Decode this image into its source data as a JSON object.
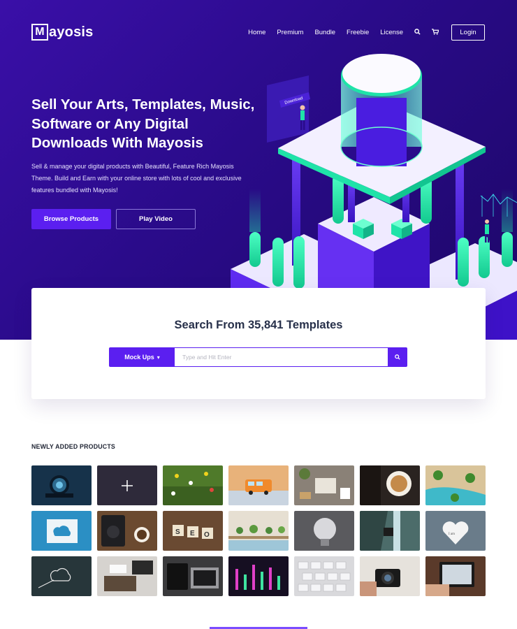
{
  "brand": {
    "logo_letter": "M",
    "logo_rest": "ayosis"
  },
  "nav": {
    "items": [
      "Home",
      "Premium",
      "Bundle",
      "Freebie",
      "License"
    ],
    "search_icon": "🔍",
    "cart_icon": "🛒",
    "login_label": "Login"
  },
  "hero": {
    "title": "Sell Your Arts, Templates, Music, Software or Any Digital Downloads With Mayosis",
    "subtitle": "Sell & manage your digital products with Beautiful, Feature Rich Mayosis Theme. Build and Earn with your online store with lots of cool and exclusive features bundled with Mayosis!",
    "browse_label": "Browse Products",
    "video_label": "Play Video",
    "illustration_sign": "Download"
  },
  "search": {
    "title": "Search From 35,841 Templates",
    "category": "Mock Ups",
    "category_caret": "▾",
    "placeholder": "Type and Hit Enter",
    "go_icon": "🔍"
  },
  "products": {
    "title": "NEWLY ADDED PRODUCTS",
    "items": [
      "camera-lens-photo",
      "add-new-placeholder",
      "wildflowers-photo",
      "toy-van-photo",
      "desk-flatlay-photo",
      "coffee-cup-photo",
      "beach-palms-photo",
      "cloud-paper-photo",
      "speaker-coffee-photo",
      "seo-tiles-photo",
      "cactus-shelf-photo",
      "light-bulb-photo",
      "camera-waterfall-photo",
      "heart-tag-photo",
      "chalk-cloud-photo",
      "laptop-desk-photo",
      "tablet-laptop-photo",
      "sound-mixer-photo",
      "keyboard-photo",
      "camera-hand-photo",
      "tablet-hand-photo"
    ]
  },
  "colors": {
    "accent": "#5b1ff0",
    "hero_bg": "#2a0b8a",
    "teal": "#1fe3a8"
  }
}
